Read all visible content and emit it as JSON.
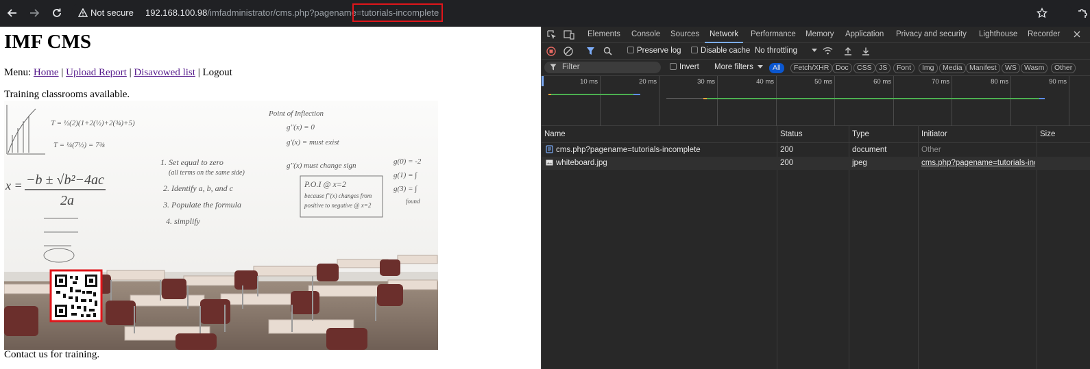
{
  "browser": {
    "security_label": "Not secure",
    "url": {
      "host": "192.168.100.98",
      "path": "/imfadministrator/cms.php?pagename",
      "param": "=tutorials-incomplete"
    }
  },
  "page": {
    "heading": "IMF CMS",
    "menu": {
      "prefix": "Menu:",
      "items": [
        "Home",
        "Upload Report",
        "Disavowed list",
        "Logout"
      ],
      "separator": "|"
    },
    "training_text": "Training classrooms available.",
    "contact_text": "Contact us for training.",
    "whiteboard": {
      "title": "Point of Inflection",
      "steps": [
        "1. Set equal to zero",
        "(all terms on the same side)",
        "2. Identify a, b, and c",
        "3. Populate the formula",
        "4. simplify"
      ],
      "formula_lhs": "x =",
      "formula_num": "−b ± √b²−4ac",
      "formula_den": "2a",
      "eq1": "T = ½(2)(1+2(½)+2(¾)+5)",
      "eq2": "T = ¼(7½) = 7⅜",
      "deriv1": "g''(x) = 0",
      "deriv2": "g'(x) = must exist",
      "deriv3": "g''(x) must change sign",
      "poi": "P.O.I @ x=2",
      "because": "because f''(x) changes from",
      "positive": "positive to negative @ x=2",
      "g1": "g(0) = -2",
      "g2": "g(1) = ∫",
      "g3": "g(3) = ∫",
      "g4": "found"
    }
  },
  "devtools": {
    "tabs": [
      "Elements",
      "Console",
      "Sources",
      "Network",
      "Performance",
      "Memory",
      "Application",
      "Privacy and security",
      "Lighthouse",
      "Recorder"
    ],
    "active_tab": "Network",
    "preserve_log": "Preserve log",
    "disable_cache": "Disable cache",
    "throttling": "No throttling",
    "filter_placeholder": "Filter",
    "invert": "Invert",
    "more_filters": "More filters",
    "type_filters": [
      "All",
      "Fetch/XHR",
      "Doc",
      "CSS",
      "JS",
      "Font",
      "Img",
      "Media",
      "Manifest",
      "WS",
      "Wasm",
      "Other"
    ],
    "timeline_ticks": [
      "10 ms",
      "20 ms",
      "30 ms",
      "40 ms",
      "50 ms",
      "60 ms",
      "70 ms",
      "80 ms",
      "90 ms"
    ],
    "columns": [
      "Name",
      "Status",
      "Type",
      "Initiator",
      "Size"
    ],
    "rows": [
      {
        "name": "cms.php?pagename=tutorials-incomplete",
        "status": "200",
        "type": "document",
        "initiator": "Other"
      },
      {
        "name": "whiteboard.jpg",
        "status": "200",
        "type": "jpeg",
        "initiator": "cms.php?pagename=tutorials-inco"
      }
    ]
  },
  "colors": {
    "highlight_box": "#e0151a",
    "active_tab_underline": "#7cacf8",
    "all_chip": "#0b57d0",
    "record_stop": "#e46962",
    "link_visited": "#551a8b"
  }
}
